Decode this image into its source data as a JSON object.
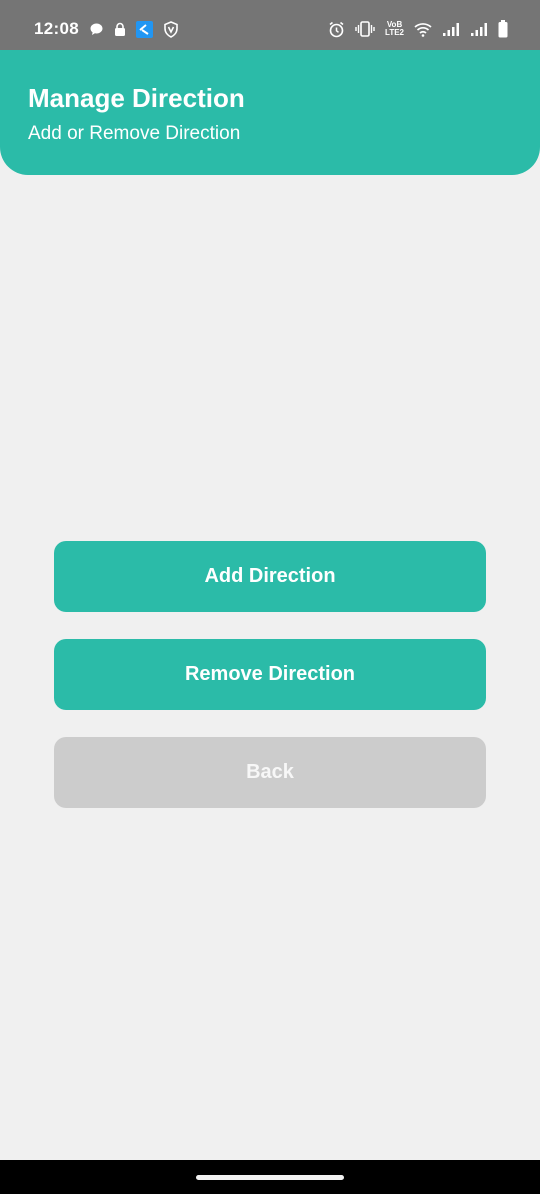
{
  "status_bar": {
    "time": "12:08",
    "left_icons": [
      "chat-bubble-icon",
      "lock-icon",
      "app-notification-icon",
      "vpn-shield-icon"
    ],
    "right_icons": [
      "alarm-icon",
      "vibrate-icon",
      "volte-icon",
      "wifi-icon",
      "signal-icon",
      "signal-icon",
      "battery-icon"
    ],
    "volte_line1": "VoB",
    "volte_line2": "LTE2"
  },
  "header": {
    "title": "Manage Direction",
    "subtitle": "Add or Remove Direction"
  },
  "actions": {
    "add_label": "Add Direction",
    "remove_label": "Remove Direction",
    "back_label": "Back"
  },
  "colors": {
    "accent": "#2bbba8",
    "background": "#f0f0f0",
    "status_bar": "#757575",
    "muted_button": "#cccccc"
  }
}
